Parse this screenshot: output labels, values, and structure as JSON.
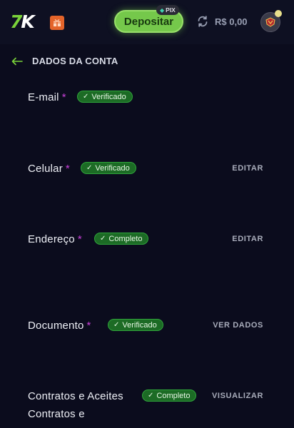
{
  "header": {
    "logo_text_a": "7",
    "logo_text_b": "K",
    "deposit_label": "Depositar",
    "pix_label": "PIX",
    "balance": "R$ 0,00"
  },
  "section": {
    "title": "DADOS DA CONTA"
  },
  "fields": [
    {
      "label": "E-mail",
      "required_mark": "*",
      "status": "Verificado",
      "action": ""
    },
    {
      "label": "Celular",
      "required_mark": "*",
      "status": "Verificado",
      "action": "EDITAR"
    },
    {
      "label": "Endereço",
      "required_mark": "*",
      "status": "Completo",
      "action": "EDITAR"
    },
    {
      "label": "Documento",
      "required_mark": "*",
      "status": "Verificado",
      "action": "VER DADOS"
    },
    {
      "label": "Contratos e Aceites",
      "sublabel": "Contratos e",
      "status": "Completo",
      "action": "VISUALIZAR"
    }
  ],
  "colors": {
    "background": "#0b0c1d",
    "accent_green": "#75c84b",
    "badge_green": "#1c6b25",
    "required_purple": "#c840d8"
  }
}
